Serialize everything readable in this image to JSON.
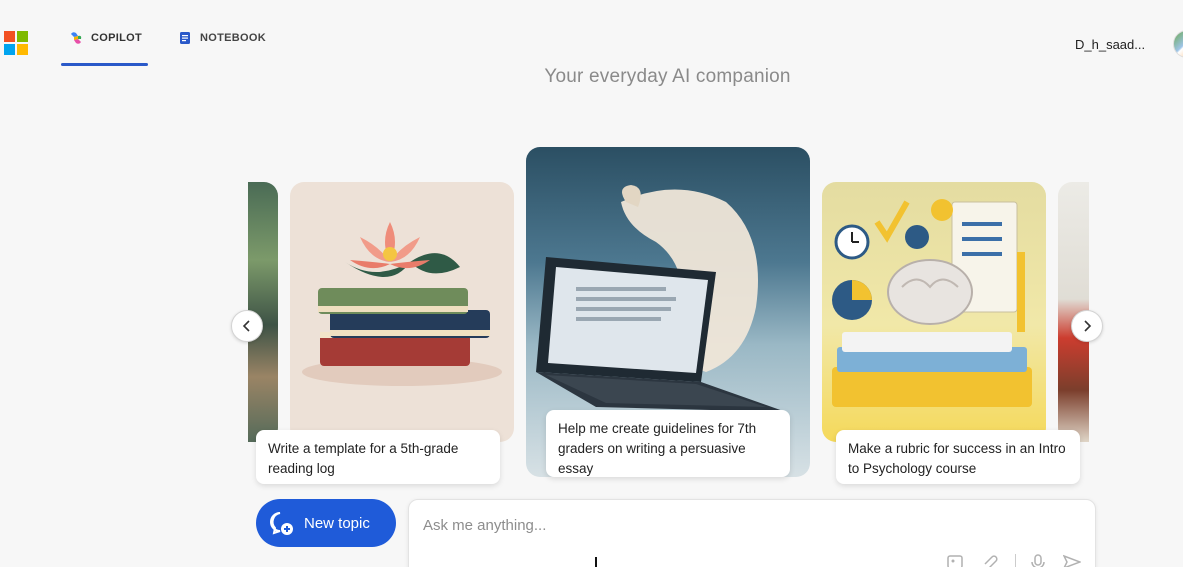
{
  "header": {
    "tabs": [
      {
        "label": "COPILOT",
        "active": true
      },
      {
        "label": "NOTEBOOK",
        "active": false
      }
    ],
    "user_name": "D_h_saad...",
    "colors": {
      "accent": "#2a59c9",
      "ms_red": "#f25022",
      "ms_green": "#7fba00",
      "ms_blue": "#00a4ef",
      "ms_yellow": "#ffb900"
    }
  },
  "main": {
    "tagline": "Your everyday AI companion",
    "cards": [
      {
        "caption": "Write a template for a 5th-grade reading log",
        "icon": "stacked-books-with-flower"
      },
      {
        "caption": "Help me create guidelines for 7th graders on writing a persuasive essay",
        "icon": "laptop-with-scroll"
      },
      {
        "caption": "Make a rubric for success in an Intro to Psychology course",
        "icon": "brain-on-books"
      }
    ]
  },
  "composer": {
    "new_topic_label": "New topic",
    "placeholder": "Ask me anything...",
    "primary_color": "#1f5bd9"
  }
}
